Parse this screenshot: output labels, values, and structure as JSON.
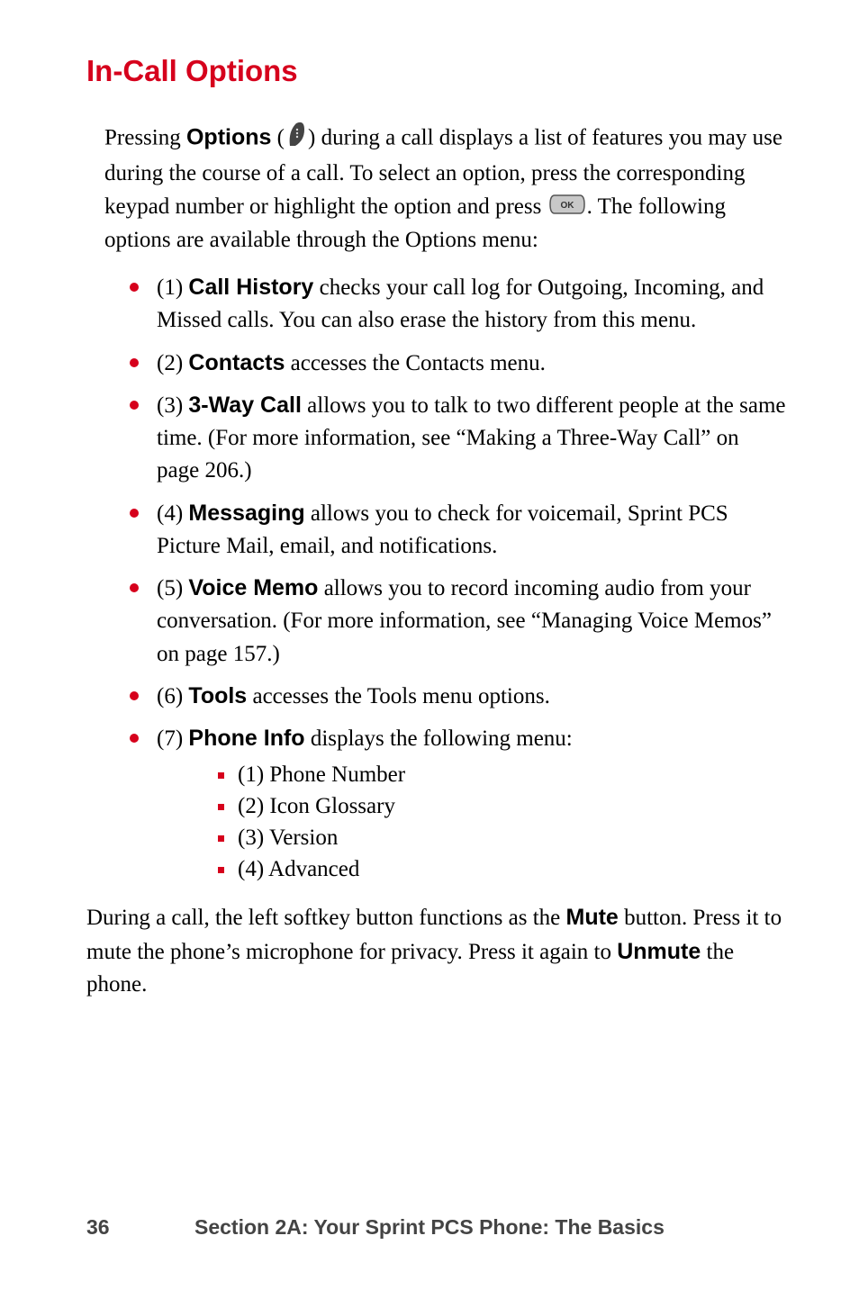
{
  "heading": "In-Call Options",
  "intro": {
    "p1a": "Pressing ",
    "options_label": "Options",
    "p1b": " (",
    "p1c": ") during a call displays a list of features you may use during the course of a call. To select an option, press the corresponding keypad number or highlight the option and press ",
    "p1d": ". The following options are available through the Options menu:"
  },
  "items": [
    {
      "num": "(1) ",
      "title": "Call History",
      "text": " checks your call log for Outgoing, Incoming, and Missed calls. You can also erase the history from this menu."
    },
    {
      "num": "(2) ",
      "title": "Contacts",
      "text": " accesses the Contacts menu."
    },
    {
      "num": "(3) ",
      "title": "3-Way Call",
      "text": " allows you to talk to two different people at the same time. (For more information, see “Making a Three-Way Call” on page 206.)"
    },
    {
      "num": "(4) ",
      "title": "Messaging",
      "text": " allows you to check for voicemail, Sprint PCS Picture Mail, email, and notifications."
    },
    {
      "num": "(5) ",
      "title": "Voice Memo",
      "text": " allows you to record incoming audio from your conversation. (For more information, see “Managing Voice Memos” on page 157.)"
    },
    {
      "num": "(6) ",
      "title": "Tools",
      "text": " accesses the Tools menu options."
    },
    {
      "num": "(7) ",
      "title": "Phone Info",
      "text": " displays the following menu:"
    }
  ],
  "phone_info_sub": [
    "(1) Phone Number",
    "(2) Icon Glossary",
    "(3) Version",
    "(4) Advanced"
  ],
  "end": {
    "a": "During a call, the left softkey button functions as the ",
    "mute": "Mute",
    "b": " button. Press it to mute the phone’s microphone for privacy. Press it again to ",
    "unmute": "Unmute",
    "c": " the phone."
  },
  "footer": {
    "page": "36",
    "section": "Section 2A: Your Sprint PCS Phone: The Basics"
  }
}
